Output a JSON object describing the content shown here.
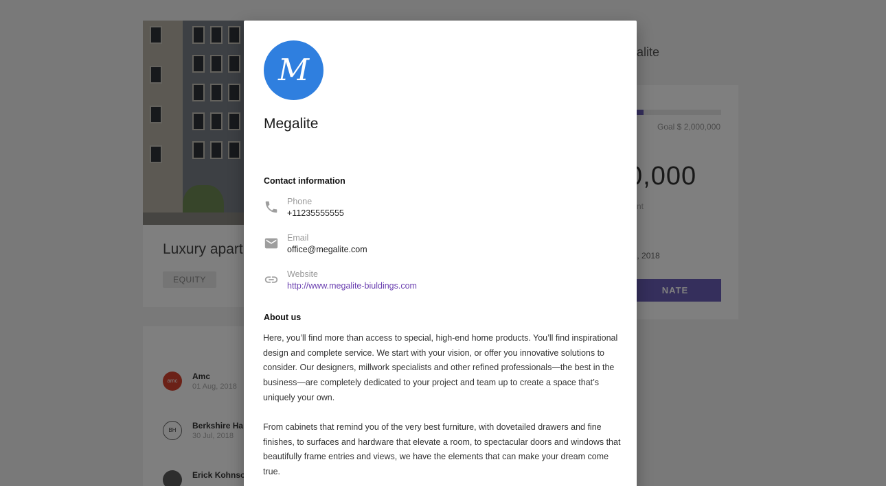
{
  "background": {
    "project_title": "Luxury apart",
    "tag": "EQUITY",
    "side_heading": "alite",
    "goal": "Goal $ 2,000,000",
    "progress_fraction": 0.08,
    "amount": "0,000",
    "side_small": "nt",
    "date": "ug, 2018",
    "donate": "NATE",
    "investors": [
      {
        "name": "Amc",
        "date": "01 Aug, 2018",
        "avatar": "amc"
      },
      {
        "name": "Berkshire Ha",
        "date": "30 Jul, 2018",
        "avatar": "BH"
      },
      {
        "name": "Erick Kohnso",
        "date": "",
        "avatar": ""
      }
    ]
  },
  "modal": {
    "logo_letter": "M",
    "company_name": "Megalite",
    "contact_title": "Contact information",
    "contacts": [
      {
        "icon": "phone-icon",
        "label": "Phone",
        "value": "+11235555555"
      },
      {
        "icon": "email-icon",
        "label": "Email",
        "value": "office@megalite.com"
      },
      {
        "icon": "link-icon",
        "label": "Website",
        "value": "http://www.megalite-biuldings.com"
      }
    ],
    "about_title": "About us",
    "about_paragraphs": [
      "Here, you’ll find more than access to special, high-end home products. You’ll find inspirational design and complete service. We start with your vision, or offer you innovative solutions to consider. Our designers, millwork specialists and other refined professionals—the best in the business—are completely dedicated to your project and team up to create a space that’s uniquely your own.",
      "From cabinets that remind you of the very best furniture, with dovetailed drawers and fine finishes, to surfaces and hardware that elevate a room, to spectacular doors and windows that beautifully frame entries and views, we have the elements that can make your dream come true."
    ]
  },
  "colors": {
    "logo": "#2f7fdf",
    "link": "#6a3fb0",
    "accent": "#6a5fb8"
  }
}
